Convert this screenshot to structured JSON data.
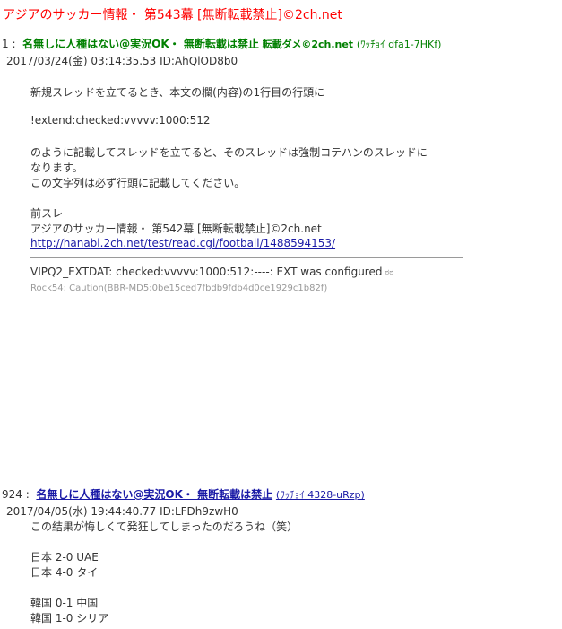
{
  "thread": {
    "title": "アジアのサッカー情報・ 第543幕 [無断転載禁止]©2ch.net"
  },
  "posts": [
    {
      "number": "1 :",
      "name_prefix": "名無しに人種はない@実況OK・ 無断転載は禁止",
      "name_suffix": "転載ダメ©2ch.net",
      "trip": "(ﾜｯﾁｮｲ dfa1-7HKf)",
      "date": "2017/03/24(金) 03:14:35.53 ID:AhQlOD8b0",
      "body": [
        "新規スレッドを立てるとき、本文の欄(内容)の1行目の行頭に",
        "!extend:checked:vvvvv:1000:512",
        "のように記載してスレッドを立てると、そのスレッドは強制コテハンのスレッドに",
        "なります。",
        "この文字列は必ず行頭に記載してください。",
        "前スレ",
        "アジアのサッカー情報・ 第542幕 [無断転載禁止]©2ch.net"
      ],
      "link": "http://hanabi.2ch.net/test/read.cgi/football/1488594153/",
      "vipq": "VIPQ2_EXTDAT: checked:vvvvv:1000:512:----: EXT was configured",
      "vipq_icon": "ಠಠ",
      "rock": "Rock54: Caution(BBR-MD5:0be15ced7fbdb9fdb4d0ce1929c1b82f)"
    },
    {
      "number": "924 :",
      "name": "名無しに人種はない@実況OK・ 無断転載は禁止",
      "trip": "(ﾜｯﾁｮｲ 4328-uRzp)",
      "date": "2017/04/05(水) 19:44:40.77 ID:LFDh9zwH0",
      "body": [
        "この結果が悔しくて発狂してしまったのだろうね（笑）",
        "日本 2-0 UAE",
        "日本 4-0 タイ",
        "韓国 0-1 中国",
        "韓国 1-0 シリア"
      ]
    }
  ]
}
